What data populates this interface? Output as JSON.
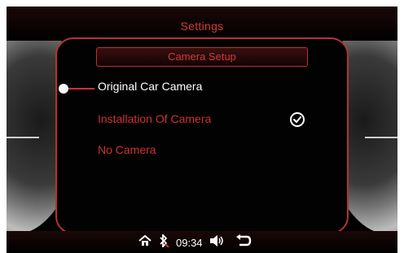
{
  "header": {
    "title": "Settings"
  },
  "panel": {
    "subtitle": "Camera Setup",
    "options": [
      {
        "label": "Original Car Camera",
        "state": "focused"
      },
      {
        "label": "Installation Of Camera",
        "state": "checked"
      },
      {
        "label": "No Camera",
        "state": "normal"
      }
    ]
  },
  "status_bar": {
    "time": "09:34",
    "icons": [
      "home-icon",
      "bluetooth-off-icon",
      "speaker-icon",
      "back-icon"
    ]
  },
  "colors": {
    "accent": "#d13131",
    "text_selected": "#ffffff",
    "background": "#000000"
  }
}
